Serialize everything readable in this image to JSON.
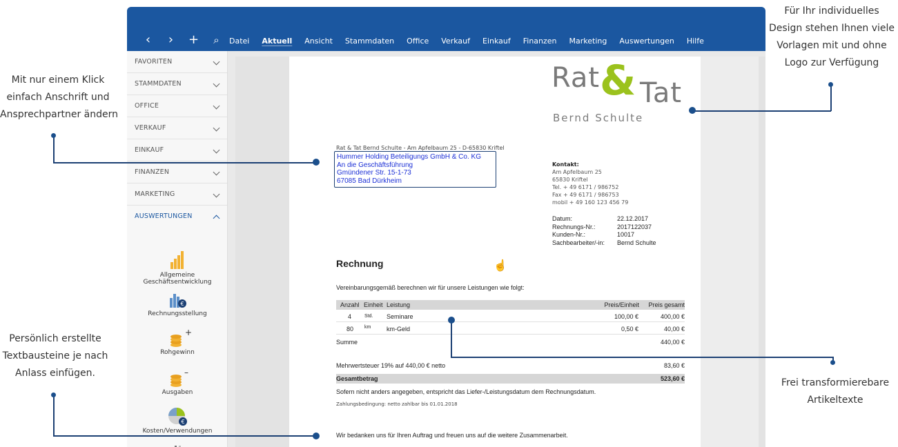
{
  "annotations": {
    "top_right": [
      "Für Ihr individuelles",
      "Design stehen Ihnen viele",
      "Vorlagen mit und ohne",
      "Logo zur Verfügung"
    ],
    "left_top": [
      "Mit nur einem Klick",
      "einfach Anschrift und",
      "Ansprechpartner ändern"
    ],
    "left_bottom": [
      "Persönlich erstellte",
      "Textbausteine je nach",
      "Anlass einfügen."
    ],
    "right_bottom": [
      "Frei transformierebare",
      "Artikeltexte"
    ]
  },
  "toolbar": {
    "icons": [
      "chevron-left-icon",
      "chevron-right-icon",
      "plus-icon",
      "search-icon"
    ],
    "menu": [
      "Datei",
      "Aktuell",
      "Ansicht",
      "Stammdaten",
      "Office",
      "Verkauf",
      "Einkauf",
      "Finanzen",
      "Marketing",
      "Auswertungen",
      "Hilfe"
    ],
    "active_menu": "Aktuell"
  },
  "sidebar": {
    "sections": [
      "FAVORITEN",
      "STAMMDATEN",
      "OFFICE",
      "VERKAUF",
      "EINKAUF",
      "FINANZEN",
      "MARKETING",
      "AUSWERTUNGEN"
    ],
    "open_section": "AUSWERTUNGEN",
    "tiles": [
      "Allgemeine Geschäftsentwicklung",
      "Rechnungsstellung",
      "Rohgewinn",
      "Ausgaben",
      "Kosten/Verwendungen"
    ]
  },
  "colors": {
    "brand_blue": "#1b57a0",
    "logo_green": "#9bc21d",
    "logo_gray": "#7a7a7a",
    "address_blue": "#1b2fd6"
  },
  "invoice": {
    "logo": {
      "word1": "Rat",
      "amp": "&",
      "word2": "Tat",
      "name": "Bernd Schulte"
    },
    "sender_line": "Rat & Tat Bernd Schulte - Am Apfelbaum 25 - D-65830 Kriftel",
    "address": [
      "Hummer Holding Beteiligungs GmbH & Co. KG",
      "An die Geschäftsführung",
      "Gmündener Str. 15-1-73",
      "67085 Bad Dürkheim"
    ],
    "contact": {
      "heading": "Kontakt:",
      "lines": [
        "Am Apfelbaum 25",
        "65830 Kriftel",
        "Tel. + 49 6171 / 986752",
        "Fax + 49 6171 / 986753",
        "mobil + 49 160 123 456 79"
      ]
    },
    "meta": [
      {
        "label": "Datum:",
        "value": "22.12.2017"
      },
      {
        "label": "Rechnungs-Nr.:",
        "value": "2017122037"
      },
      {
        "label": "Kunden-Nr.:",
        "value": "10017"
      },
      {
        "label": "Sachbearbeiter/-in:",
        "value": "Bernd Schulte"
      }
    ],
    "title": "Rechnung",
    "intro": "Vereinbarungsgemäß berechnen wir für unsere Leistungen wie folgt:",
    "columns": {
      "qty": "Anzahl",
      "unit": "Einheit",
      "service": "Leistung",
      "price": "Preis/Einheit",
      "total": "Preis gesamt"
    },
    "rows": [
      {
        "qty": "4",
        "unit": "Std.",
        "service": "Seminare",
        "price": "100,00 €",
        "total": "400,00 €"
      },
      {
        "qty": "80",
        "unit": "km",
        "service": "km-Geld",
        "price": "0,50 €",
        "total": "40,00 €"
      }
    ],
    "sum_label": "Summe",
    "sum_value": "440,00 €",
    "vat_label": "Mehrwertsteuer 19% auf 440,00 € netto",
    "vat_value": "83,60 €",
    "total_label": "Gesamtbetrag",
    "total_value": "523,60 €",
    "note": "Sofern nicht anders angegeben, entspricht das Liefer-/Leistungsdatum dem Rechnungsdatum.",
    "payment": "Zahlungsbedingung: netto zahlbar bis 01.01.2018",
    "thanks": "Wir bedanken uns für Ihren Auftrag und freuen uns auf die weitere Zusammenarbeit."
  }
}
